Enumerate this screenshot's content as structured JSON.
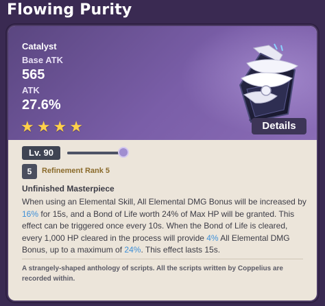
{
  "title": "Flowing Purity",
  "weapon": {
    "type": "Catalyst",
    "base_stat_name": "Base ATK",
    "base_stat_value": "565",
    "sub_stat_name": "ATK",
    "sub_stat_value": "27.6%",
    "rarity": 4,
    "star_glyph": "★"
  },
  "details_label": "Details",
  "level_label": "Lv. 90",
  "level_fraction": 1.0,
  "refinement": {
    "rank_number": "5",
    "label": "Refinement Rank 5"
  },
  "passive": {
    "name": "Unfinished Masterpiece",
    "desc_parts": [
      "When using an Elemental Skill, All Elemental DMG Bonus will be increased by ",
      "16%",
      " for 15s, and a Bond of Life worth 24% of Max HP will be granted. This effect can be triggered once every 10s. When the Bond of Life is cleared, every 1,000 HP cleared in the process will provide ",
      "4%",
      " All Elemental DMG Bonus, up to a maximum of ",
      "24%",
      ". This effect lasts 15s."
    ]
  },
  "lore": "A strangely-shaped anthology of scripts. All the scripts written by Coppelius are recorded within.",
  "colors": {
    "background": "#3a2a52",
    "header_gradient_start": "#5a4680",
    "header_gradient_end": "#8a6cb6",
    "card_body": "#ece5da",
    "star": "#ffd04a",
    "highlight": "#3d8fd8",
    "refinement_text": "#8a6a2a"
  },
  "icons": [
    "star-icon",
    "weapon-catalyst-icon",
    "slider-knob"
  ]
}
